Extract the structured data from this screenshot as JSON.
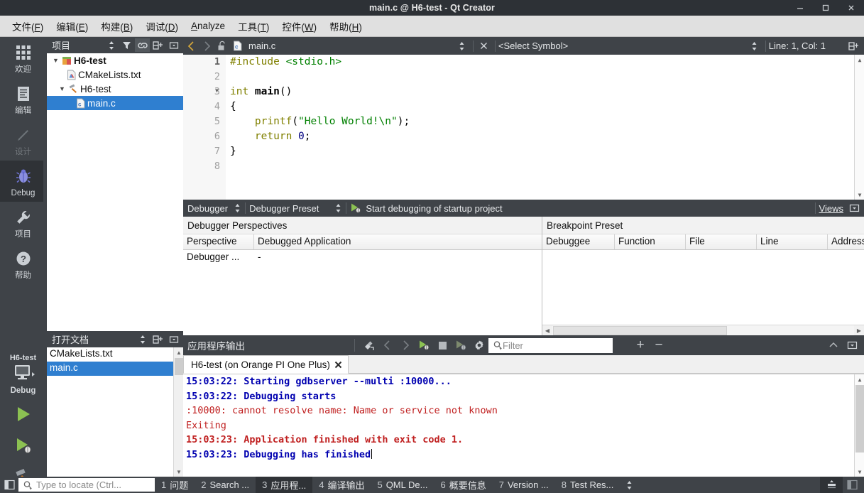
{
  "window": {
    "title": "main.c @ H6-test - Qt Creator",
    "minimize_label": "minimize",
    "maximize_label": "maximize",
    "close_label": "close"
  },
  "menu": {
    "items": [
      {
        "text": "文件(F)",
        "plain": "文件",
        "mnemonic": "F"
      },
      {
        "text": "编辑(E)",
        "plain": "编辑",
        "mnemonic": "E"
      },
      {
        "text": "构建(B)",
        "plain": "构建",
        "mnemonic": "B"
      },
      {
        "text": "调试(D)",
        "plain": "调试",
        "mnemonic": "D"
      },
      {
        "text": "Analyze",
        "plain": "",
        "mnemonic": "A"
      },
      {
        "text": "工具(T)",
        "plain": "工具",
        "mnemonic": "T"
      },
      {
        "text": "控件(W)",
        "plain": "控件",
        "mnemonic": "W"
      },
      {
        "text": "帮助(H)",
        "plain": "帮助",
        "mnemonic": "H"
      }
    ]
  },
  "modebar": {
    "modes": [
      {
        "label": "欢迎",
        "icon": "grid-icon",
        "state": "normal"
      },
      {
        "label": "编辑",
        "icon": "document-icon",
        "state": "normal"
      },
      {
        "label": "设计",
        "icon": "pencil-icon",
        "state": "disabled"
      },
      {
        "label": "Debug",
        "icon": "bug-icon",
        "state": "active"
      },
      {
        "label": "项目",
        "icon": "wrench-icon",
        "state": "normal"
      },
      {
        "label": "帮助",
        "icon": "question-icon",
        "state": "normal"
      }
    ],
    "kit": {
      "project": "H6-test",
      "build_config": "Debug",
      "icon": "desktop-icon"
    },
    "actions": [
      {
        "name": "run",
        "icon": "play-icon"
      },
      {
        "name": "debug",
        "icon": "play-bug-icon"
      },
      {
        "name": "build",
        "icon": "hammer-icon"
      }
    ]
  },
  "projects_pane": {
    "title": "项目",
    "header_icons": [
      "sync-selection-icon",
      "filter-icon",
      "link-icon",
      "split-icon",
      "close-pane-icon"
    ],
    "tree": [
      {
        "depth": 0,
        "label": "H6-test",
        "icon": "project-icon",
        "expander": "down",
        "bold": true,
        "selected": false
      },
      {
        "depth": 1,
        "label": "CMakeLists.txt",
        "icon": "cmake-file-icon",
        "expander": "none",
        "bold": false,
        "selected": false
      },
      {
        "depth": 1,
        "label": "H6-test",
        "icon": "build-target-icon",
        "expander": "down",
        "bold": false,
        "selected": false
      },
      {
        "depth": 2,
        "label": "main.c",
        "icon": "c-file-icon",
        "expander": "none",
        "bold": false,
        "selected": true
      }
    ]
  },
  "open_documents_pane": {
    "title": "打开文档",
    "header_icons": [
      "sync-selection-icon",
      "split-icon",
      "close-pane-icon"
    ],
    "items": [
      {
        "label": "CMakeLists.txt",
        "selected": false
      },
      {
        "label": "main.c",
        "selected": true
      }
    ]
  },
  "editor_toolbar": {
    "back_icon": "chevron-left-icon",
    "forward_icon": "chevron-right-icon",
    "lock_icon": "unlock-icon",
    "file_icon": "c-file-icon",
    "filename": "main.c",
    "file_combo_icon": "updown-arrows-icon",
    "close_icon": "close-icon",
    "symbol_selector": "<Select Symbol>",
    "symbol_combo_icon": "updown-arrows-icon",
    "cursor_position": "Line: 1, Col: 1",
    "split_icon": "split-icon"
  },
  "editor": {
    "lines": [
      {
        "n": 1,
        "fold": false,
        "tokens": [
          {
            "t": "#include ",
            "c": "k-pre"
          },
          {
            "t": "<stdio.h>",
            "c": "k-inc"
          }
        ]
      },
      {
        "n": 2,
        "fold": false,
        "tokens": []
      },
      {
        "n": 3,
        "fold": true,
        "tokens": [
          {
            "t": "int ",
            "c": "k-kw"
          },
          {
            "t": "main",
            "c": "k-fn"
          },
          {
            "t": "()",
            "c": "k-op"
          }
        ]
      },
      {
        "n": 4,
        "fold": false,
        "tokens": [
          {
            "t": "{",
            "c": "k-op"
          }
        ]
      },
      {
        "n": 5,
        "fold": false,
        "tokens": [
          {
            "t": "    printf",
            "c": "k-call"
          },
          {
            "t": "(",
            "c": "k-op"
          },
          {
            "t": "\"Hello World!\\n\"",
            "c": "k-str"
          },
          {
            "t": ");",
            "c": "k-op"
          }
        ]
      },
      {
        "n": 6,
        "fold": false,
        "tokens": [
          {
            "t": "    return ",
            "c": "k-kw"
          },
          {
            "t": "0",
            "c": "k-num"
          },
          {
            "t": ";",
            "c": "k-op"
          }
        ]
      },
      {
        "n": 7,
        "fold": false,
        "tokens": [
          {
            "t": "}",
            "c": "k-op"
          }
        ]
      },
      {
        "n": 8,
        "fold": false,
        "tokens": []
      }
    ]
  },
  "debugger_toolbar": {
    "perspective": "Debugger",
    "perspective_combo_icon": "updown-arrows-icon",
    "preset": "Debugger Preset",
    "preset_combo_icon": "updown-arrows-icon",
    "start_action": "Start debugging of startup project",
    "start_icon": "play-bug-icon",
    "views": "Views",
    "menu_icon": "dropdown-box-icon"
  },
  "debugger_perspectives": {
    "group_title": "Debugger Perspectives",
    "columns": [
      "Perspective",
      "Debugged Application"
    ],
    "rows": [
      [
        "Debugger ...",
        "-"
      ]
    ]
  },
  "breakpoint_preset": {
    "group_title": "Breakpoint Preset",
    "columns": [
      "Debuggee",
      "Function",
      "File",
      "Line",
      "Address"
    ],
    "rows": []
  },
  "output_pane": {
    "title": "应用程序输出",
    "toolbar_icons": [
      {
        "name": "clear-icon",
        "enabled": true
      },
      {
        "name": "prev-item-icon",
        "enabled": false
      },
      {
        "name": "next-item-icon",
        "enabled": false
      },
      {
        "name": "run-icon",
        "enabled": true
      },
      {
        "name": "stop-icon",
        "enabled": true
      },
      {
        "name": "rerun-debug-icon",
        "enabled": false
      },
      {
        "name": "settings-gear-icon",
        "enabled": true
      }
    ],
    "filter_placeholder": "Filter",
    "filter_value": "",
    "filter_icon": "search-filter-icon",
    "zoom_in_label": "+",
    "zoom_out_label": "−",
    "maximize_icon": "chevron-up-icon",
    "menu_icon": "dropdown-box-icon",
    "tabs": [
      {
        "label": "H6-test (on Orange PI One Plus)",
        "active": true,
        "close_icon": "close-x-icon"
      }
    ],
    "lines": [
      {
        "text": "15:03:22: Starting gdbserver --multi :10000...",
        "style": "o-blue"
      },
      {
        "text": "15:03:22: Debugging starts",
        "style": "o-blue"
      },
      {
        "text": ":10000: cannot resolve name: Name or service not known",
        "style": "o-red"
      },
      {
        "text": "Exiting",
        "style": "o-red"
      },
      {
        "text": "15:03:23: Application finished with exit code 1.",
        "style": "o-redb"
      },
      {
        "text": "15:03:23: Debugging has finished",
        "style": "o-blue",
        "caret": true
      }
    ]
  },
  "statusbar": {
    "sidebar_toggle_icon": "sidebar-toggle-icon",
    "locate_placeholder": "Type to locate (Ctrl...",
    "locate_value": "",
    "locate_icon": "search-icon",
    "tabs": [
      {
        "num": "1",
        "label": "问题",
        "active": false
      },
      {
        "num": "2",
        "label": "Search ...",
        "active": false
      },
      {
        "num": "3",
        "label": "应用程...",
        "active": true
      },
      {
        "num": "4",
        "label": "编译输出",
        "active": false
      },
      {
        "num": "5",
        "label": "QML De...",
        "active": false
      },
      {
        "num": "6",
        "label": "概要信息",
        "active": false
      },
      {
        "num": "7",
        "label": "Version ...",
        "active": false
      },
      {
        "num": "8",
        "label": "Test Res...",
        "active": false
      }
    ],
    "overflow_icon": "updown-arrows-icon",
    "progress_icon": "progress-icon",
    "right_sidebar_toggle_icon": "sidebar-toggle-icon"
  },
  "colors": {
    "chrome_dark": "#3f4348",
    "titlebar": "#2d3136",
    "menubar": "#e0e0e0",
    "selection_blue": "#2f7fd0",
    "output_blue": "#0000b0",
    "output_red": "#c02020",
    "string_green": "#008000",
    "keyword_olive": "#808000"
  }
}
